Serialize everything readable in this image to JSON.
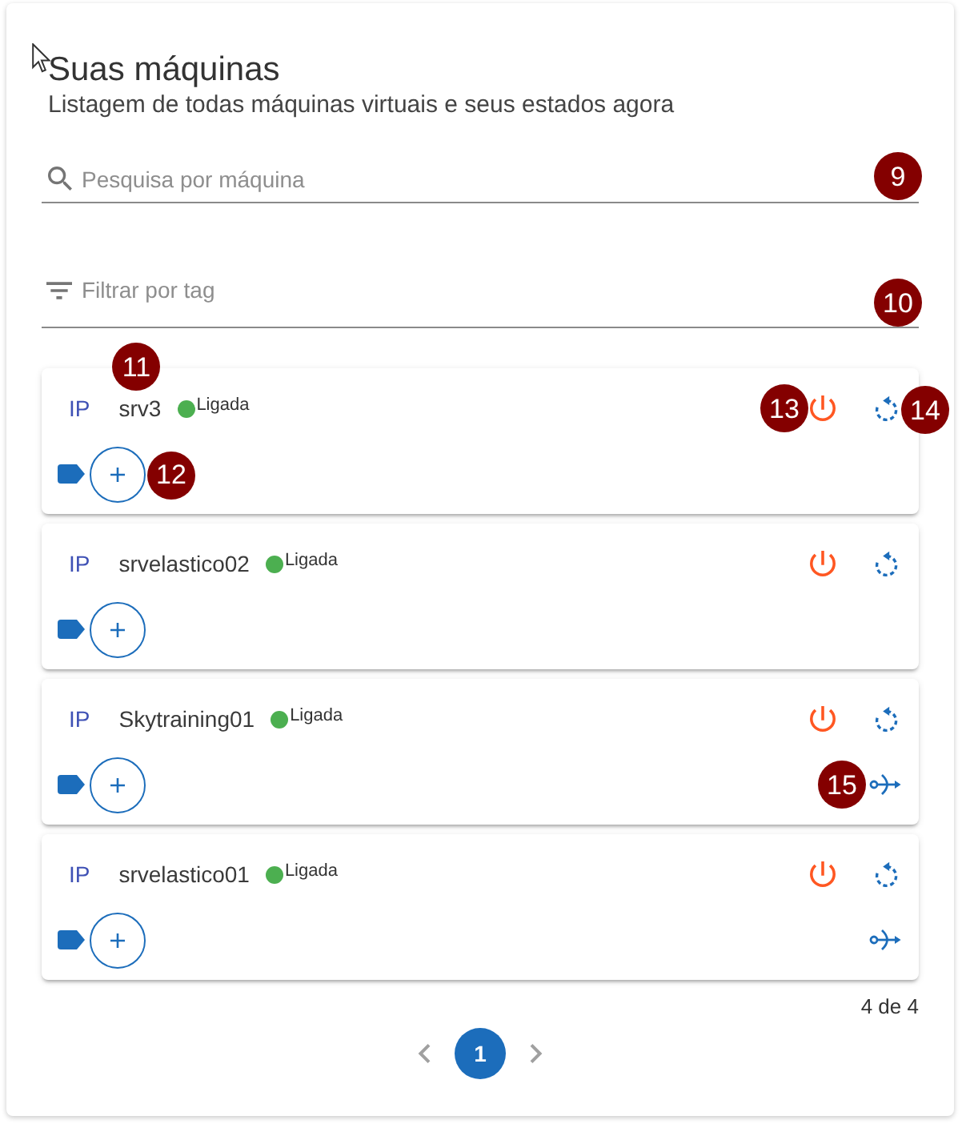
{
  "header": {
    "title": "Suas máquinas",
    "subtitle": "Listagem de todas máquinas virtuais e seus estados agora"
  },
  "search": {
    "placeholder": "Pesquisa por máquina",
    "marker": "9"
  },
  "filter": {
    "placeholder": "Filtrar por tag",
    "marker": "10"
  },
  "machines": [
    {
      "ip_label": "IP",
      "name": "srv3",
      "status": {
        "label": "Ligada",
        "color": "#4caf50"
      },
      "connect": false,
      "markers": {
        "name": "11",
        "tag": "12",
        "power": "13",
        "restart": "14"
      }
    },
    {
      "ip_label": "IP",
      "name": "srvelastico02",
      "status": {
        "label": "Ligada",
        "color": "#4caf50"
      },
      "connect": false
    },
    {
      "ip_label": "IP",
      "name": "Skytraining01",
      "status": {
        "label": "Ligada",
        "color": "#4caf50"
      },
      "connect": true,
      "markers": {
        "connect": "15"
      }
    },
    {
      "ip_label": "IP",
      "name": "srvelastico01",
      "status": {
        "label": "Ligada",
        "color": "#4caf50"
      },
      "connect": true
    }
  ],
  "count": "4 de 4",
  "pagination": {
    "prev_disabled": true,
    "next_disabled": true,
    "pages": [
      {
        "label": "1",
        "selected": true
      }
    ]
  }
}
